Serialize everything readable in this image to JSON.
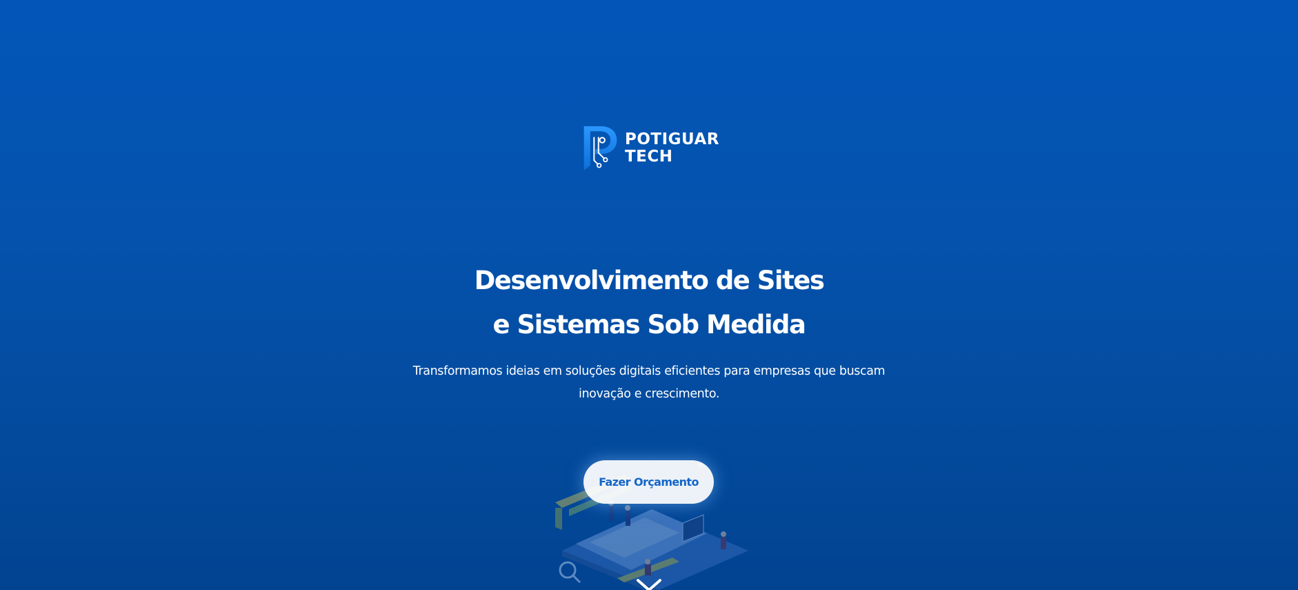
{
  "brand": {
    "line1": "POTIGUAR",
    "line2": "TECH",
    "accent_color": "#1e88f0"
  },
  "hero": {
    "headline_line1": "Desenvolvimento de Sites",
    "headline_line2": "e Sistemas Sob Medida",
    "subtitle": "Transformamos ideias em soluções digitais eficientes para empresas que buscam inovação e crescimento.",
    "cta_label": "Fazer Orçamento",
    "background_color": "#0452ad",
    "cta_text_color": "#1466c9"
  },
  "icons": {
    "logo": "circuit-p-logo-icon",
    "scroll": "chevron-down-icon",
    "illustration": "isometric-web-development-illustration"
  }
}
